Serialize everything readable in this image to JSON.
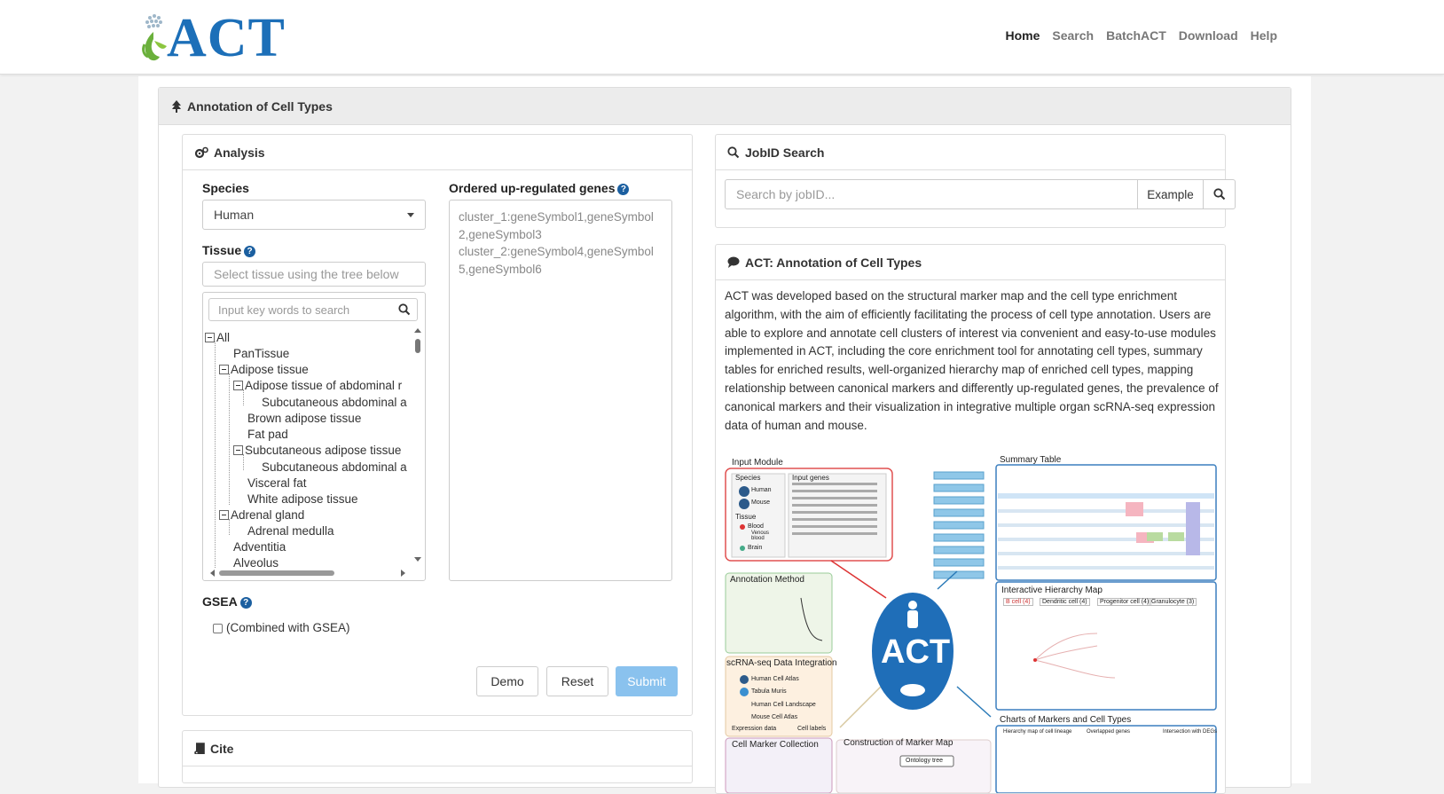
{
  "header": {
    "logo_text": "ACT",
    "nav": [
      {
        "label": "Home",
        "active": true
      },
      {
        "label": "Search",
        "active": false
      },
      {
        "label": "BatchACT",
        "active": false
      },
      {
        "label": "Download",
        "active": false
      },
      {
        "label": "Help",
        "active": false
      }
    ]
  },
  "main": {
    "title": "Annotation of Cell Types",
    "analysis": {
      "title": "Analysis",
      "species_label": "Species",
      "species_value": "Human",
      "tissue_label": "Tissue",
      "tissue_placeholder": "Select tissue using the tree below",
      "tree_search_placeholder": "Input key words to search",
      "tree": {
        "root": "All",
        "pantissue": "PanTissue",
        "adipose": "Adipose tissue",
        "adipose_abdominal": "Adipose tissue of abdominal r",
        "subcut_abd_1": "Subcutaneous abdominal a",
        "brown": "Brown adipose tissue",
        "fat_pad": "Fat pad",
        "subcut_adipose": "Subcutaneous adipose tissue",
        "subcut_abd_2": "Subcutaneous abdominal a",
        "visceral": "Visceral fat",
        "white": "White adipose tissue",
        "adrenal": "Adrenal gland",
        "adrenal_medulla": "Adrenal medulla",
        "adventitia": "Adventitia",
        "alveolus": "Alveolus"
      },
      "genes_label": "Ordered up-regulated genes",
      "genes_placeholder": "cluster_1:geneSymbol1,geneSymbol2,geneSymbol3\ncluster_2:geneSymbol4,geneSymbol5,geneSymbol6",
      "gsea_label": "GSEA",
      "gsea_checkbox": "(Combined with GSEA)",
      "demo": "Demo",
      "reset": "Reset",
      "submit": "Submit"
    },
    "jobsearch": {
      "title": "JobID Search",
      "placeholder": "Search by jobID...",
      "example": "Example"
    },
    "about": {
      "title": "ACT: Annotation of Cell Types",
      "text": "ACT was developed based on the structural marker map and the cell type enrichment algorithm, with the aim of efficiently facilitating the process of cell type annotation. Users are able to explore and annotate cell clusters of interest via convenient and easy-to-use modules implemented in ACT, including the core enrichment tool for annotating cell types, summary tables for enriched results, well-organized hierarchy map of enriched cell types, mapping relationship between canonical markers and differently up-regulated genes, the prevalence of canonical markers and their visualization in integrative multiple organ scRNA-seq expression data of human and mouse."
    },
    "figure": {
      "input_module": "Input Module",
      "species": "Species",
      "human": "Human",
      "mouse": "Mouse",
      "tissue": "Tissue",
      "blood": "Blood",
      "venous_blood": "Venous blood",
      "brain": "Brain",
      "input_genes": "Input genes",
      "summary_table": "Summary Table",
      "annotation_method": "Annotation Method",
      "scrna_integration": "scRNA-seq Data Integration",
      "human_cell_atlas": "Human Cell Atlas",
      "tabula_muris": "Tabula Muris",
      "human_cell_landscape": "Human Cell Landscape",
      "mouse_cell_atlas": "Mouse Cell Atlas",
      "expression_data": "Expression data",
      "cell_labels": "Cell labels",
      "marker_collection": "Cell Marker Collection",
      "construction_map": "Construction of Marker Map",
      "ontology_tree": "Ontology tree",
      "hierarchy_map": "Interactive Hierarchy Map",
      "b_cell": "B cell (4)",
      "dendritic_cell": "Dendritic cell (4)",
      "progenitor_cell": "Progenitor cell (4)",
      "granulocyte": "Granulocyte (3)",
      "charts": "Charts of Markers and Cell Types",
      "hier_lineage": "Hierarchy map of cell lineage",
      "overlapped_genes": "Overlapped genes",
      "intersection_degs": "Intersection with DEGs",
      "center": "ACT"
    },
    "cite_title": "Cite"
  },
  "colors": {
    "brand_blue": "#1c6fb8",
    "submit_bg": "#8ac2ee",
    "help_icon": "#1b5fa0"
  }
}
